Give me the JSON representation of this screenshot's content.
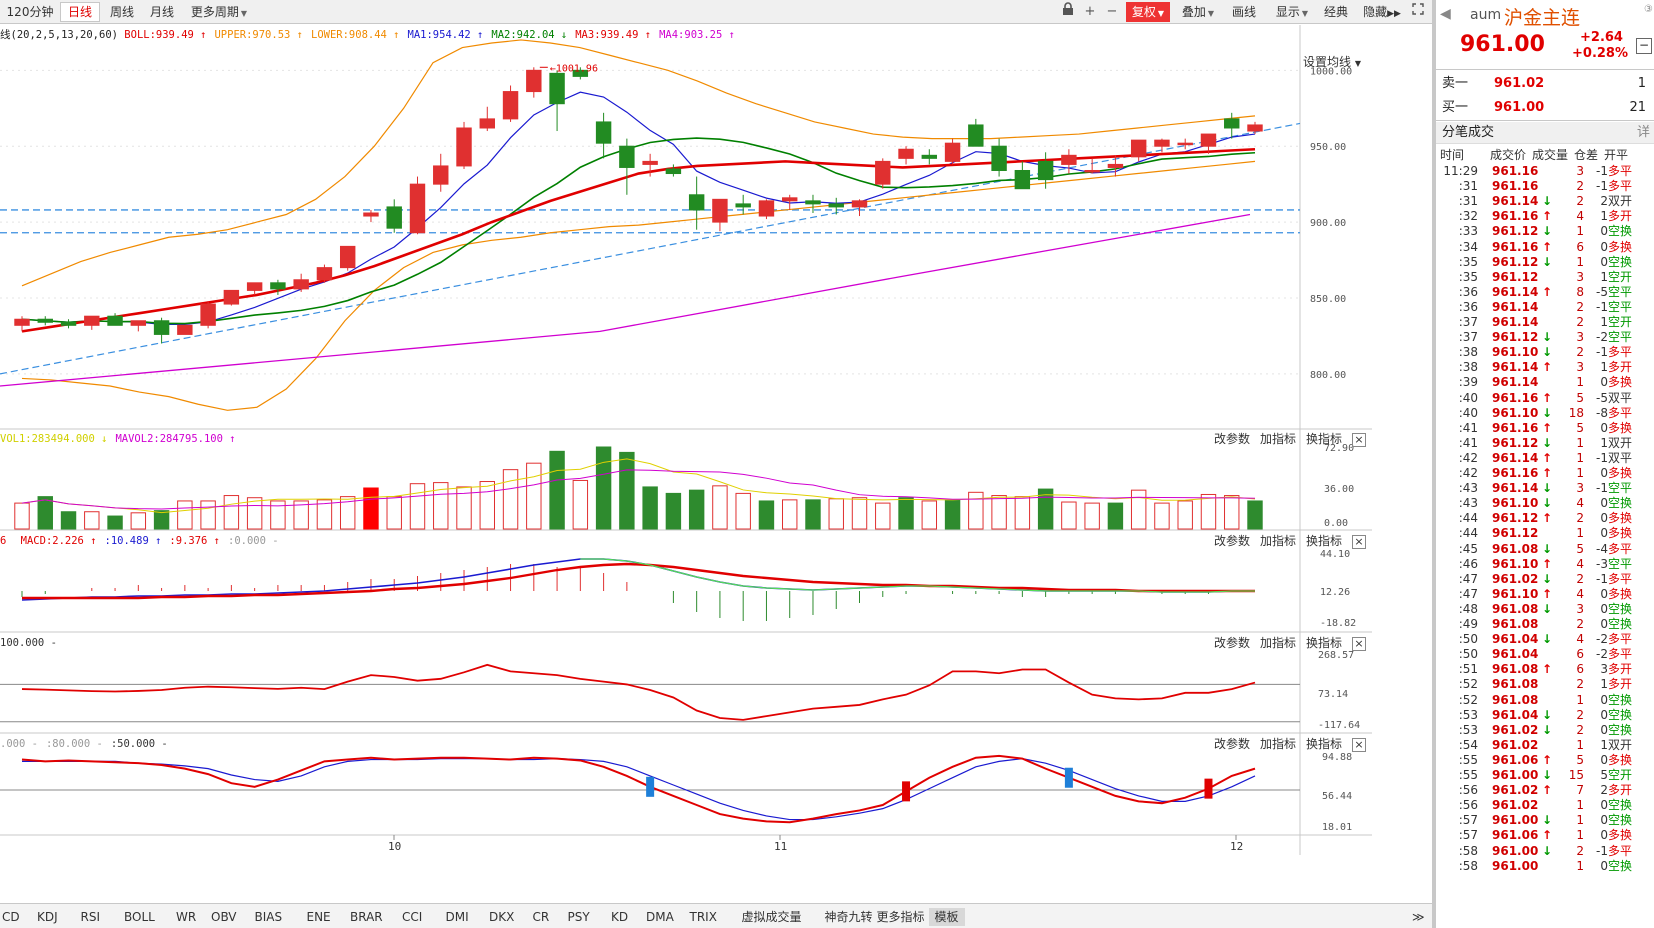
{
  "toolbar": {
    "periods": [
      "120分钟",
      "日线",
      "周线",
      "月线",
      "更多周期"
    ],
    "active_period": "日线",
    "right_buttons": [
      "复权",
      "叠加",
      "画线",
      "显示",
      "经典",
      "隐藏"
    ],
    "icons": [
      "lock-icon",
      "plus-icon",
      "minus-icon",
      "fullscreen-icon"
    ]
  },
  "legend_main": {
    "prefix": "线(20,2,5,13,20,60)",
    "items": [
      {
        "label": "BOLL:939.49",
        "arrow": "↑",
        "color": "#e00000"
      },
      {
        "label": "UPPER:970.53",
        "arrow": "↑",
        "color": "#f08a00"
      },
      {
        "label": "LOWER:908.44",
        "arrow": "↑",
        "color": "#f08a00"
      },
      {
        "label": "MA1:954.42",
        "arrow": "↑",
        "color": "#1a1ad0"
      },
      {
        "label": "MA2:942.04",
        "arrow": "↓",
        "color": "#008000"
      },
      {
        "label": "MA3:939.49",
        "arrow": "↑",
        "color": "#e00000"
      },
      {
        "label": "MA4:903.25",
        "arrow": "↑",
        "color": "#d000d0"
      }
    ],
    "set_ma": "设置均线"
  },
  "legend_vol": {
    "items": [
      {
        "label": "VOL1:283494.000",
        "arrow": "↓",
        "color": "#d0d000"
      },
      {
        "label": "MAVOL2:284795.100",
        "arrow": "↑",
        "color": "#d000d0"
      }
    ]
  },
  "legend_macd": {
    "items": [
      {
        "label": "6",
        "arrow": "",
        "color": "#e00000"
      },
      {
        "label": "MACD:2.226",
        "arrow": "↑",
        "color": "#e00000"
      },
      {
        "label": ":10.489",
        "arrow": "↑",
        "color": "#1a1ad0"
      },
      {
        "label": ":9.376",
        "arrow": "↑",
        "color": "#e00000"
      },
      {
        "label": ":0.000",
        "arrow": "-",
        "color": "#999999"
      }
    ]
  },
  "legend_cci": {
    "items": [
      {
        "label": "100.000",
        "arrow": "-",
        "color": "#333333"
      }
    ]
  },
  "legend_kdj": {
    "items": [
      {
        "label": ".000",
        "arrow": "-",
        "color": "#999999"
      },
      {
        "label": ":80.000",
        "arrow": "-",
        "color": "#999999"
      },
      {
        "label": ":50.000",
        "arrow": "-",
        "color": "#333333"
      }
    ]
  },
  "pane_buttons": [
    "改参数",
    "加指标",
    "换指标"
  ],
  "indicator_tabs": [
    "CD",
    "KDJ",
    "RSI",
    "BOLL",
    "WR",
    "OBV",
    "BIAS",
    "ENE",
    "BRAR",
    "CCI",
    "DMI",
    "DKX",
    "CR",
    "PSY",
    "KD",
    "DMA",
    "TRIX",
    "虚拟成交量",
    "神奇九转",
    "更多指标",
    "模板"
  ],
  "active_tab": "模板",
  "x_labels": [
    "10",
    "11",
    "12"
  ],
  "y_axis": {
    "main": [
      "1000.00",
      "950.00",
      "900.00",
      "850.00",
      "800.00"
    ],
    "vol": [
      "72.90",
      "36.00",
      "0.00"
    ],
    "macd": [
      "44.10",
      "12.26",
      "-18.82"
    ],
    "cci": [
      "268.57",
      "73.14",
      "-117.64"
    ],
    "kdj": [
      "94.88",
      "56.44",
      "18.01"
    ]
  },
  "max_price_label": "1001.96",
  "quote": {
    "code": "aum",
    "name": "沪金主连",
    "price": "961.00",
    "change": "+2.64",
    "change_pct": "+0.28%",
    "sell_label": "卖一",
    "sell_price": "961.02",
    "sell_vol": "1",
    "buy_label": "买一",
    "buy_price": "961.00",
    "buy_vol": "21"
  },
  "ticks_panel": {
    "title": "分笔成交",
    "detail": "详",
    "headers": [
      "时间",
      "成交价",
      "成交量",
      "仓差",
      "开平"
    ],
    "rows": [
      {
        "t": "11:29",
        "p": "961.16",
        "a": "",
        "v": "3",
        "oi": "-1",
        "type": "多平"
      },
      {
        "t": ":31",
        "p": "961.16",
        "a": "",
        "v": "2",
        "oi": "-1",
        "type": "多平"
      },
      {
        "t": ":31",
        "p": "961.14",
        "a": "↓",
        "v": "2",
        "oi": "2",
        "type": "双开"
      },
      {
        "t": ":32",
        "p": "961.16",
        "a": "↑",
        "v": "4",
        "oi": "1",
        "type": "多开"
      },
      {
        "t": ":33",
        "p": "961.12",
        "a": "↓",
        "v": "1",
        "oi": "0",
        "type": "空换"
      },
      {
        "t": ":34",
        "p": "961.16",
        "a": "↑",
        "v": "6",
        "oi": "0",
        "type": "多换"
      },
      {
        "t": ":35",
        "p": "961.12",
        "a": "↓",
        "v": "1",
        "oi": "0",
        "type": "空换"
      },
      {
        "t": ":35",
        "p": "961.12",
        "a": "",
        "v": "3",
        "oi": "1",
        "type": "空开"
      },
      {
        "t": ":36",
        "p": "961.14",
        "a": "↑",
        "v": "8",
        "oi": "-5",
        "type": "空平"
      },
      {
        "t": ":36",
        "p": "961.14",
        "a": "",
        "v": "2",
        "oi": "-1",
        "type": "空平"
      },
      {
        "t": ":37",
        "p": "961.14",
        "a": "",
        "v": "2",
        "oi": "1",
        "type": "空开"
      },
      {
        "t": ":37",
        "p": "961.12",
        "a": "↓",
        "v": "3",
        "oi": "-2",
        "type": "空平"
      },
      {
        "t": ":38",
        "p": "961.10",
        "a": "↓",
        "v": "2",
        "oi": "-1",
        "type": "多平"
      },
      {
        "t": ":38",
        "p": "961.14",
        "a": "↑",
        "v": "3",
        "oi": "1",
        "type": "多开"
      },
      {
        "t": ":39",
        "p": "961.14",
        "a": "",
        "v": "1",
        "oi": "0",
        "type": "多换"
      },
      {
        "t": ":40",
        "p": "961.16",
        "a": "↑",
        "v": "5",
        "oi": "-5",
        "type": "双平"
      },
      {
        "t": ":40",
        "p": "961.10",
        "a": "↓",
        "v": "18",
        "oi": "-8",
        "type": "多平"
      },
      {
        "t": ":41",
        "p": "961.16",
        "a": "↑",
        "v": "5",
        "oi": "0",
        "type": "多换"
      },
      {
        "t": ":41",
        "p": "961.12",
        "a": "↓",
        "v": "1",
        "oi": "1",
        "type": "双开"
      },
      {
        "t": ":42",
        "p": "961.14",
        "a": "↑",
        "v": "1",
        "oi": "-1",
        "type": "双平"
      },
      {
        "t": ":42",
        "p": "961.16",
        "a": "↑",
        "v": "1",
        "oi": "0",
        "type": "多换"
      },
      {
        "t": ":43",
        "p": "961.14",
        "a": "↓",
        "v": "3",
        "oi": "-1",
        "type": "空平"
      },
      {
        "t": ":43",
        "p": "961.10",
        "a": "↓",
        "v": "4",
        "oi": "0",
        "type": "空换"
      },
      {
        "t": ":44",
        "p": "961.12",
        "a": "↑",
        "v": "2",
        "oi": "0",
        "type": "多换"
      },
      {
        "t": ":44",
        "p": "961.12",
        "a": "",
        "v": "1",
        "oi": "0",
        "type": "多换"
      },
      {
        "t": ":45",
        "p": "961.08",
        "a": "↓",
        "v": "5",
        "oi": "-4",
        "type": "多平"
      },
      {
        "t": ":46",
        "p": "961.10",
        "a": "↑",
        "v": "4",
        "oi": "-3",
        "type": "空平"
      },
      {
        "t": ":47",
        "p": "961.02",
        "a": "↓",
        "v": "2",
        "oi": "-1",
        "type": "多平"
      },
      {
        "t": ":47",
        "p": "961.10",
        "a": "↑",
        "v": "4",
        "oi": "0",
        "type": "多换"
      },
      {
        "t": ":48",
        "p": "961.08",
        "a": "↓",
        "v": "3",
        "oi": "0",
        "type": "空换"
      },
      {
        "t": ":49",
        "p": "961.08",
        "a": "",
        "v": "2",
        "oi": "0",
        "type": "空换"
      },
      {
        "t": ":50",
        "p": "961.04",
        "a": "↓",
        "v": "4",
        "oi": "-2",
        "type": "多平"
      },
      {
        "t": ":50",
        "p": "961.04",
        "a": "",
        "v": "6",
        "oi": "-2",
        "type": "多平"
      },
      {
        "t": ":51",
        "p": "961.08",
        "a": "↑",
        "v": "6",
        "oi": "3",
        "type": "多开"
      },
      {
        "t": ":52",
        "p": "961.08",
        "a": "",
        "v": "2",
        "oi": "1",
        "type": "多开"
      },
      {
        "t": ":52",
        "p": "961.08",
        "a": "",
        "v": "1",
        "oi": "0",
        "type": "空换"
      },
      {
        "t": ":53",
        "p": "961.04",
        "a": "↓",
        "v": "2",
        "oi": "0",
        "type": "空换"
      },
      {
        "t": ":53",
        "p": "961.02",
        "a": "↓",
        "v": "2",
        "oi": "0",
        "type": "空换"
      },
      {
        "t": ":54",
        "p": "961.02",
        "a": "",
        "v": "1",
        "oi": "1",
        "type": "双开"
      },
      {
        "t": ":55",
        "p": "961.06",
        "a": "↑",
        "v": "5",
        "oi": "0",
        "type": "多换"
      },
      {
        "t": ":55",
        "p": "961.00",
        "a": "↓",
        "v": "15",
        "oi": "5",
        "type": "空开"
      },
      {
        "t": ":56",
        "p": "961.02",
        "a": "↑",
        "v": "7",
        "oi": "2",
        "type": "多开"
      },
      {
        "t": ":56",
        "p": "961.02",
        "a": "",
        "v": "1",
        "oi": "0",
        "type": "空换"
      },
      {
        "t": ":57",
        "p": "961.00",
        "a": "↓",
        "v": "1",
        "oi": "0",
        "type": "空换"
      },
      {
        "t": ":57",
        "p": "961.06",
        "a": "↑",
        "v": "1",
        "oi": "0",
        "type": "多换"
      },
      {
        "t": ":58",
        "p": "961.00",
        "a": "↓",
        "v": "2",
        "oi": "-1",
        "type": "多平"
      },
      {
        "t": ":58",
        "p": "961.00",
        "a": "",
        "v": "1",
        "oi": "0",
        "type": "空换"
      }
    ]
  },
  "chart_data": {
    "type": "candlestick",
    "price_axis": [
      1000,
      950,
      900,
      850,
      800
    ],
    "candles": [
      [
        832,
        838,
        828,
        836
      ],
      [
        836,
        838,
        832,
        834
      ],
      [
        834,
        836,
        830,
        832
      ],
      [
        832,
        838,
        829,
        838
      ],
      [
        838,
        840,
        832,
        832
      ],
      [
        832,
        835,
        828,
        835
      ],
      [
        835,
        837,
        820,
        826
      ],
      [
        826,
        832,
        826,
        832
      ],
      [
        832,
        848,
        830,
        846
      ],
      [
        846,
        855,
        845,
        855
      ],
      [
        855,
        860,
        852,
        860
      ],
      [
        860,
        862,
        852,
        856
      ],
      [
        856,
        866,
        854,
        862
      ],
      [
        862,
        872,
        860,
        870
      ],
      [
        870,
        884,
        868,
        884
      ],
      [
        904,
        908,
        900,
        906
      ],
      [
        910,
        915,
        893,
        896
      ],
      [
        893,
        930,
        892,
        925
      ],
      [
        925,
        945,
        920,
        937
      ],
      [
        937,
        966,
        935,
        962
      ],
      [
        962,
        976,
        960,
        968
      ],
      [
        968,
        990,
        966,
        986
      ],
      [
        986,
        1002,
        982,
        1000
      ],
      [
        998,
        1000,
        960,
        978
      ],
      [
        1000,
        1002,
        994,
        996
      ],
      [
        966,
        972,
        942,
        952
      ],
      [
        950,
        955,
        918,
        936
      ],
      [
        938,
        945,
        930,
        940
      ],
      [
        935,
        938,
        930,
        932
      ],
      [
        918,
        930,
        895,
        908
      ],
      [
        900,
        908,
        894,
        915
      ],
      [
        912,
        918,
        905,
        910
      ],
      [
        904,
        915,
        902,
        914
      ],
      [
        914,
        918,
        908,
        916
      ],
      [
        914,
        918,
        906,
        912
      ],
      [
        912,
        916,
        905,
        910
      ],
      [
        910,
        915,
        904,
        914
      ],
      [
        925,
        942,
        922,
        940
      ],
      [
        942,
        950,
        938,
        948
      ],
      [
        944,
        948,
        938,
        942
      ],
      [
        940,
        955,
        938,
        952
      ],
      [
        964,
        968,
        950,
        950
      ],
      [
        950,
        955,
        930,
        934
      ],
      [
        934,
        940,
        922,
        922
      ],
      [
        940,
        946,
        922,
        928
      ],
      [
        938,
        948,
        932,
        944
      ],
      [
        934,
        942,
        932,
        934
      ],
      [
        936,
        944,
        930,
        938
      ],
      [
        943,
        952,
        940,
        954
      ],
      [
        950,
        955,
        946,
        954
      ],
      [
        952,
        955,
        948,
        952
      ],
      [
        950,
        958,
        945,
        958
      ],
      [
        968,
        972,
        955,
        962
      ],
      [
        960,
        966,
        958,
        964
      ]
    ],
    "volume": [
      24,
      30,
      16,
      16,
      12,
      15,
      17,
      26,
      26,
      31,
      29,
      26,
      26,
      27,
      30,
      38,
      30,
      42,
      43,
      39,
      44,
      55,
      61,
      72,
      45,
      76,
      71,
      39,
      33,
      36,
      40,
      33,
      26,
      27,
      27,
      28,
      29,
      24,
      29,
      26,
      27,
      34,
      31,
      30,
      37,
      25,
      24,
      24,
      36,
      24,
      26,
      32,
      31,
      26
    ],
    "volume_up": [
      false,
      true,
      true,
      false,
      true,
      false,
      true,
      false,
      false,
      false,
      false,
      false,
      false,
      false,
      false,
      true,
      false,
      false,
      false,
      false,
      false,
      false,
      false,
      true,
      false,
      true,
      true,
      true,
      true,
      true,
      false,
      false,
      true,
      false,
      true,
      false,
      false,
      false,
      true,
      false,
      true,
      false,
      false,
      false,
      true,
      false,
      false,
      true,
      false,
      false,
      false,
      false,
      false,
      true
    ],
    "macd_dif": [
      3,
      4,
      5,
      6,
      6,
      7,
      7,
      8,
      8,
      9,
      9,
      10,
      11,
      12,
      14,
      16,
      18,
      20,
      23,
      26,
      30,
      34,
      38,
      41,
      44,
      44,
      42,
      38,
      32,
      26,
      21,
      17,
      15,
      14,
      13,
      14,
      15,
      16,
      17,
      17,
      16,
      15,
      14,
      13,
      12,
      12,
      12,
      12,
      12,
      11,
      11,
      11,
      12,
      12
    ],
    "macd_dea": [
      5,
      5,
      5,
      5,
      5,
      5,
      6,
      6,
      7,
      7,
      8,
      8,
      9,
      10,
      11,
      12,
      14,
      15,
      17,
      19,
      22,
      25,
      29,
      33,
      36,
      38,
      39,
      38,
      36,
      33,
      30,
      27,
      25,
      23,
      21,
      20,
      19,
      18,
      18,
      17,
      17,
      16,
      15,
      15,
      14,
      13,
      13,
      13,
      12,
      12,
      12,
      12,
      12,
      12
    ],
    "cci": [
      75,
      72,
      68,
      64,
      62,
      65,
      70,
      82,
      88,
      85,
      80,
      76,
      82,
      75,
      115,
      150,
      140,
      120,
      130,
      165,
      205,
      170,
      160,
      150,
      130,
      115,
      100,
      70,
      30,
      -40,
      -80,
      -90,
      -70,
      -50,
      -30,
      -20,
      -10,
      20,
      45,
      95,
      170,
      170,
      160,
      180,
      180,
      110,
      45,
      25,
      20,
      25,
      55,
      55,
      75,
      110
    ],
    "kdj_k": [
      90,
      88,
      89,
      88,
      87,
      86,
      84,
      80,
      74,
      64,
      60,
      68,
      78,
      88,
      90,
      92,
      90,
      91,
      92,
      92,
      91,
      90,
      92,
      91,
      89,
      82,
      72,
      60,
      50,
      40,
      30,
      25,
      22,
      21,
      25,
      30,
      34,
      40,
      55,
      70,
      82,
      92,
      94,
      91,
      80,
      70,
      60,
      50,
      44,
      42,
      48,
      58,
      72,
      80
    ],
    "kdj_d": [
      88,
      88,
      88,
      88,
      88,
      86,
      85,
      83,
      80,
      73,
      68,
      66,
      72,
      82,
      88,
      90,
      90,
      90,
      91,
      91,
      91,
      90,
      90,
      91,
      90,
      88,
      82,
      72,
      62,
      52,
      42,
      34,
      28,
      24,
      24,
      27,
      31,
      36,
      46,
      58,
      70,
      82,
      88,
      91,
      86,
      78,
      68,
      58,
      50,
      44,
      44,
      50,
      60,
      72
    ],
    "boll_upper": [
      858,
      866,
      874,
      880,
      885,
      890,
      892,
      895,
      900,
      905,
      915,
      930,
      950,
      975,
      1005,
      1015,
      1018,
      1020,
      1018,
      1015,
      1010,
      1005,
      1000,
      993,
      985,
      978,
      972,
      966,
      962,
      958,
      956,
      955,
      955,
      955,
      956,
      957,
      958,
      960,
      962,
      964,
      966,
      968,
      970
    ],
    "boll_lower": [
      797,
      796,
      794,
      792,
      788,
      785,
      780,
      776,
      778,
      790,
      810,
      835,
      855,
      870,
      880,
      885,
      888,
      890,
      893,
      895,
      897,
      898,
      900,
      902,
      904,
      906,
      908,
      910,
      912,
      914,
      916,
      918,
      920,
      922,
      924,
      926,
      928,
      930,
      932,
      934,
      936,
      938,
      940
    ],
    "ma_red": [
      828,
      831,
      834,
      837,
      840,
      843,
      846,
      849,
      852,
      856,
      860,
      865,
      871,
      878,
      885,
      892,
      900,
      907,
      914,
      920,
      926,
      932,
      935,
      937,
      938,
      939,
      940,
      939,
      938,
      937,
      936,
      937,
      938,
      939,
      940,
      941,
      942,
      943,
      944,
      945,
      946,
      947,
      948
    ]
  }
}
